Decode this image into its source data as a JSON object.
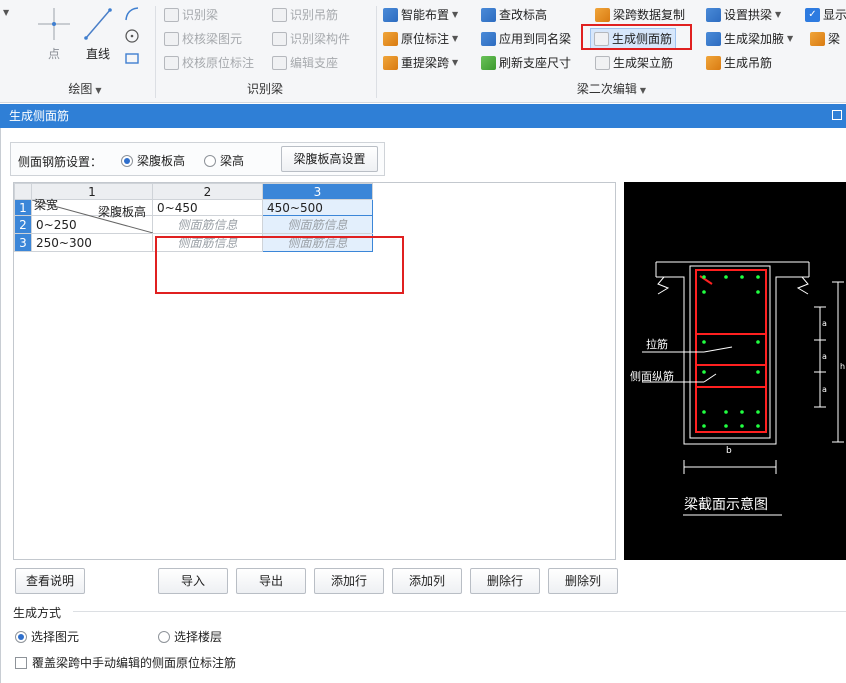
{
  "ribbon": {
    "draw_group": {
      "point": "点",
      "line": "直线",
      "label": "绘图"
    },
    "identify_group": {
      "identify_beam": "识别梁",
      "identify_hanger": "识别吊筋",
      "check_beam_element": "校核梁图元",
      "identify_beam_member": "识别梁构件",
      "check_original_annotation": "校核原位标注",
      "edit_support": "编辑支座",
      "label": "识别梁"
    },
    "secondary_edit_group": {
      "smart_layout": "智能布置",
      "check_elevation": "查改标高",
      "span_data_copy": "梁跨数据复制",
      "set_arch_beam": "设置拱梁",
      "show": "显示",
      "original_annotation": "原位标注",
      "apply_same_name": "应用到同名梁",
      "generate_side_rebar": "生成侧面筋",
      "generate_haunch": "生成梁加腋",
      "beam_short": "梁",
      "re_extract_span": "重提梁跨",
      "refresh_support_size": "刷新支座尺寸",
      "generate_erection_rebar": "生成架立筋",
      "generate_hanger": "生成吊筋",
      "label": "梁二次编辑"
    }
  },
  "dialog": {
    "title": "生成侧面筋",
    "settings": {
      "label": "侧面钢筋设置：",
      "option_web_height": "梁腹板高",
      "option_beam_height": "梁高",
      "settings_button": "梁腹板高设置"
    },
    "grid": {
      "col_numbers": [
        "1",
        "2",
        "3"
      ],
      "corner_top": "梁腹板高",
      "corner_bottom": "梁宽",
      "header_ranges": [
        "0~450",
        "450~500"
      ],
      "rows": [
        {
          "num": "2",
          "range": "0~250",
          "cells": [
            "侧面筋信息",
            "侧面筋信息"
          ]
        },
        {
          "num": "3",
          "range": "250~300",
          "cells": [
            "侧面筋信息",
            "侧面筋信息"
          ]
        }
      ],
      "row1_num": "1"
    },
    "diagram": {
      "tie_label": "拉筋",
      "side_long_label": "侧面纵筋",
      "b_label": "b",
      "a_labels": [
        "a",
        "a",
        "a"
      ],
      "h_label": "h",
      "caption": "梁截面示意图"
    },
    "buttons": {
      "view_help": "查看说明",
      "import": "导入",
      "export": "导出",
      "add_row": "添加行",
      "add_col": "添加列",
      "delete_row": "删除行",
      "delete_col": "删除列"
    },
    "generation": {
      "label": "生成方式",
      "select_element": "选择图元",
      "select_floor": "选择楼层",
      "overwrite_label": "覆盖梁跨中手动编辑的侧面原位标注筋"
    }
  }
}
